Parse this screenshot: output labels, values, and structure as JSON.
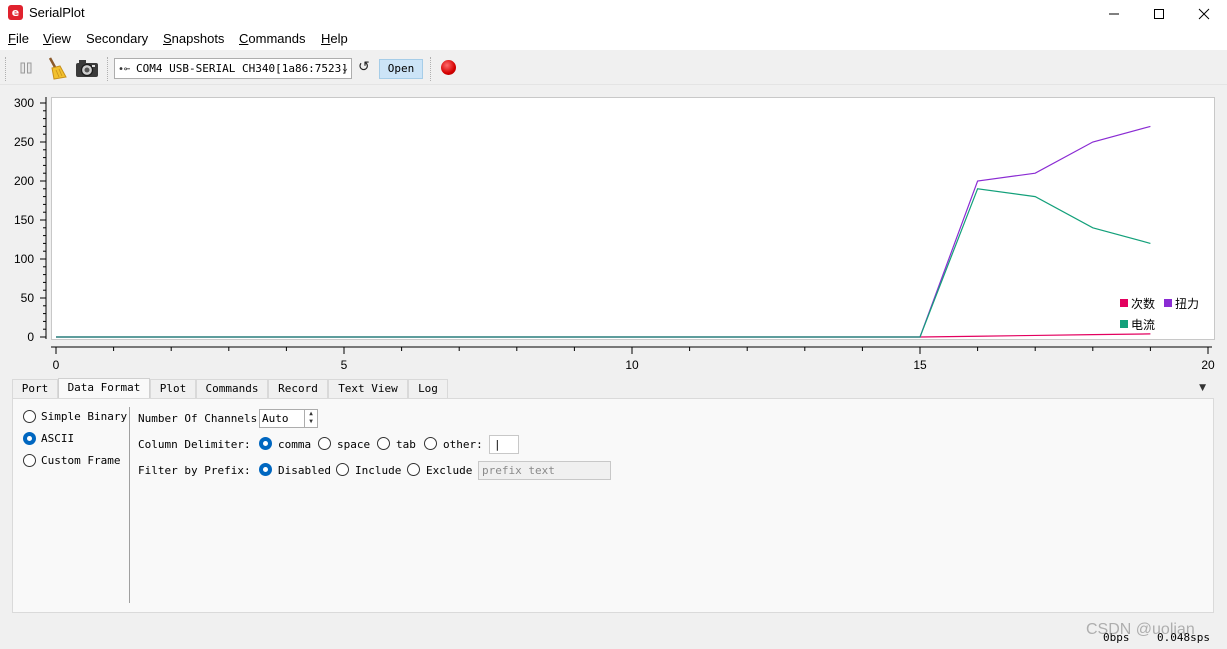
{
  "window": {
    "title": "SerialPlot",
    "minimize_glyph": "—",
    "maximize_glyph": "☐",
    "close_glyph": "✕"
  },
  "menu": {
    "items": [
      {
        "label_u": "F",
        "label_rest": "ile"
      },
      {
        "label_u": "V",
        "label_rest": "iew"
      },
      {
        "label_u": "",
        "label_rest": "Secondary"
      },
      {
        "label_u": "S",
        "label_rest": "napshots"
      },
      {
        "label_u": "C",
        "label_rest": "ommands"
      },
      {
        "label_u": "H",
        "label_rest": "elp"
      }
    ]
  },
  "toolbar": {
    "port_value": "COM4 USB-SERIAL CH340[1a86:7523]",
    "open_label": "Open",
    "icons": [
      "pause-icon",
      "clear-broom-icon",
      "snapshot-camera-icon",
      "usb-icon",
      "refresh-icon",
      "record-icon"
    ]
  },
  "chart_data": {
    "type": "line",
    "xlim": [
      0,
      20
    ],
    "ylim": [
      0,
      300
    ],
    "x_ticks": [
      "0",
      "5",
      "10",
      "15",
      "20"
    ],
    "y_ticks": [
      "300",
      "250",
      "200",
      "150",
      "100",
      "50",
      "0"
    ],
    "legend_position": "right",
    "series": [
      {
        "name": "次数",
        "color": "#e3005f",
        "x": [
          0,
          1,
          2,
          3,
          4,
          5,
          6,
          7,
          8,
          9,
          10,
          11,
          12,
          13,
          14,
          15,
          16,
          17,
          18,
          19
        ],
        "y": [
          0,
          0,
          0,
          0,
          0,
          0,
          0,
          0,
          0,
          0,
          0,
          0,
          0,
          0,
          0,
          0,
          1,
          2,
          3,
          4
        ]
      },
      {
        "name": "扭力",
        "color": "#8a2bd3",
        "x": [
          0,
          1,
          2,
          3,
          4,
          5,
          6,
          7,
          8,
          9,
          10,
          11,
          12,
          13,
          14,
          15,
          16,
          17,
          18,
          19
        ],
        "y": [
          0,
          0,
          0,
          0,
          0,
          0,
          0,
          0,
          0,
          0,
          0,
          0,
          0,
          0,
          0,
          0,
          200,
          210,
          250,
          270
        ]
      },
      {
        "name": "电流",
        "color": "#13a07a",
        "x": [
          0,
          1,
          2,
          3,
          4,
          5,
          6,
          7,
          8,
          9,
          10,
          11,
          12,
          13,
          14,
          15,
          16,
          17,
          18,
          19
        ],
        "y": [
          0,
          0,
          0,
          0,
          0,
          0,
          0,
          0,
          0,
          0,
          0,
          0,
          0,
          0,
          0,
          0,
          190,
          180,
          140,
          120
        ]
      }
    ]
  },
  "tabs": [
    "Port",
    "Data Format",
    "Plot",
    "Commands",
    "Record",
    "Text View",
    "Log"
  ],
  "data_format": {
    "formats": [
      "Simple Binary",
      "ASCII",
      "Custom Frame"
    ],
    "selected_format": "ASCII",
    "channels_label": "Number Of Channels:",
    "channels_value": "Auto",
    "delimiter_label": "Column Delimiter:",
    "delimiters": [
      "comma",
      "space",
      "tab",
      "other:"
    ],
    "selected_delimiter": "comma",
    "other_value": "|",
    "prefix_label": "Filter by Prefix:",
    "prefix_modes": [
      "Disabled",
      "Include",
      "Exclude"
    ],
    "selected_prefix_mode": "Disabled",
    "prefix_placeholder": "prefix text"
  },
  "status": {
    "bps": "0bps",
    "sps": "0.048sps"
  },
  "watermark": "CSDN @uolian"
}
